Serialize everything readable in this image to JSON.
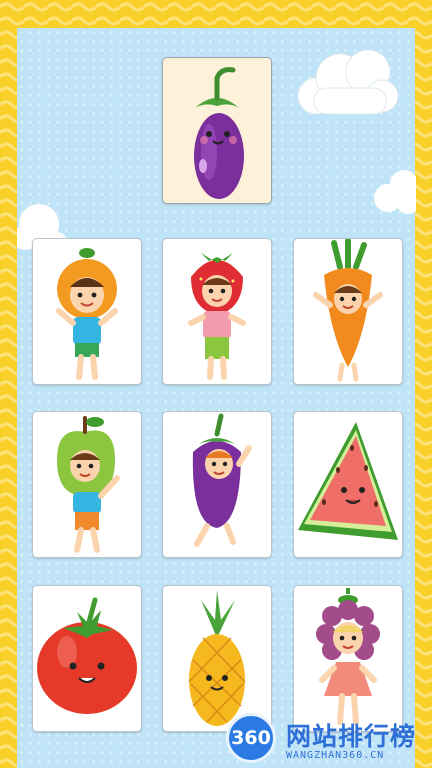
{
  "game": {
    "target": {
      "item": "eggplant",
      "icon": "eggplant-icon"
    },
    "cards": [
      {
        "item": "orange-costume-kid",
        "icon": "orange-kid-icon"
      },
      {
        "item": "strawberry-costume-kid",
        "icon": "strawberry-kid-icon"
      },
      {
        "item": "carrot-costume-kid",
        "icon": "carrot-kid-icon"
      },
      {
        "item": "apple-costume-kid",
        "icon": "apple-kid-icon"
      },
      {
        "item": "eggplant-costume-kid",
        "icon": "eggplant-kid-icon"
      },
      {
        "item": "watermelon-slice",
        "icon": "watermelon-icon"
      },
      {
        "item": "tomato",
        "icon": "tomato-icon"
      },
      {
        "item": "pineapple",
        "icon": "pineapple-icon"
      },
      {
        "item": "grape-costume-kid",
        "icon": "grape-kid-icon"
      }
    ]
  },
  "watermark": {
    "badge": "360",
    "title": "网站排行榜",
    "subtitle": "WANGZHAN360.CN"
  },
  "colors": {
    "border_yellow": "#f9cf2a",
    "sky_blue": "#bfe3f7",
    "target_card_bg": "#fdf1da",
    "watermark_blue": "#2e6fd8"
  }
}
